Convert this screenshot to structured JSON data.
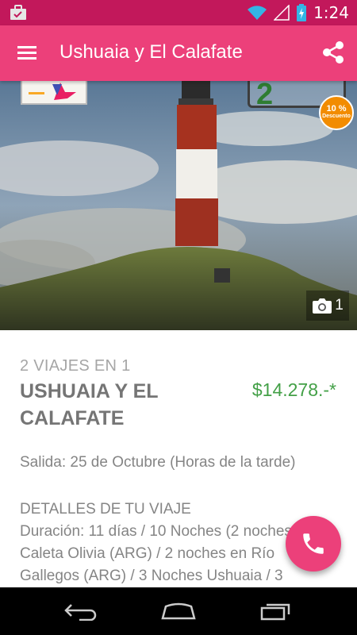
{
  "status_bar": {
    "time": "1:24",
    "icons": [
      "briefcase-check-icon",
      "wifi-icon",
      "signal-icon",
      "battery-charging-icon"
    ]
  },
  "app_bar": {
    "title": "Ushuaia y El Calafate",
    "menu_icon": "hamburger-menu-icon",
    "share_icon": "share-icon"
  },
  "hero": {
    "logo_text": "2",
    "badge_percent": "10 %",
    "badge_label": "Descuento",
    "photo_count": "1",
    "camera_icon": "camera-icon"
  },
  "content": {
    "subtitle": "2 VIAJES EN 1",
    "title": "USHUAIA Y EL CALAFATE",
    "price": "$14.278.-*",
    "departure": "Salida: 25 de Octubre (Horas de la tarde)",
    "details_heading": "DETALLES DE TU VIAJE",
    "details_lines": [
      "Duración: 11 días / 10 Noches (2 noches",
      "Caleta Olivia (ARG) / 2 noches en Río",
      "Gallegos (ARG) / 3 Noches Ushuaia / 3"
    ]
  },
  "fab": {
    "icon": "phone-icon"
  },
  "nav_bar": {
    "back_icon": "back-icon",
    "home_icon": "home-icon",
    "recents_icon": "recent-apps-icon"
  },
  "colors": {
    "status_bar": "#c2185b",
    "app_bar": "#ec407a",
    "price": "#43a047",
    "fab": "#ec407a"
  }
}
